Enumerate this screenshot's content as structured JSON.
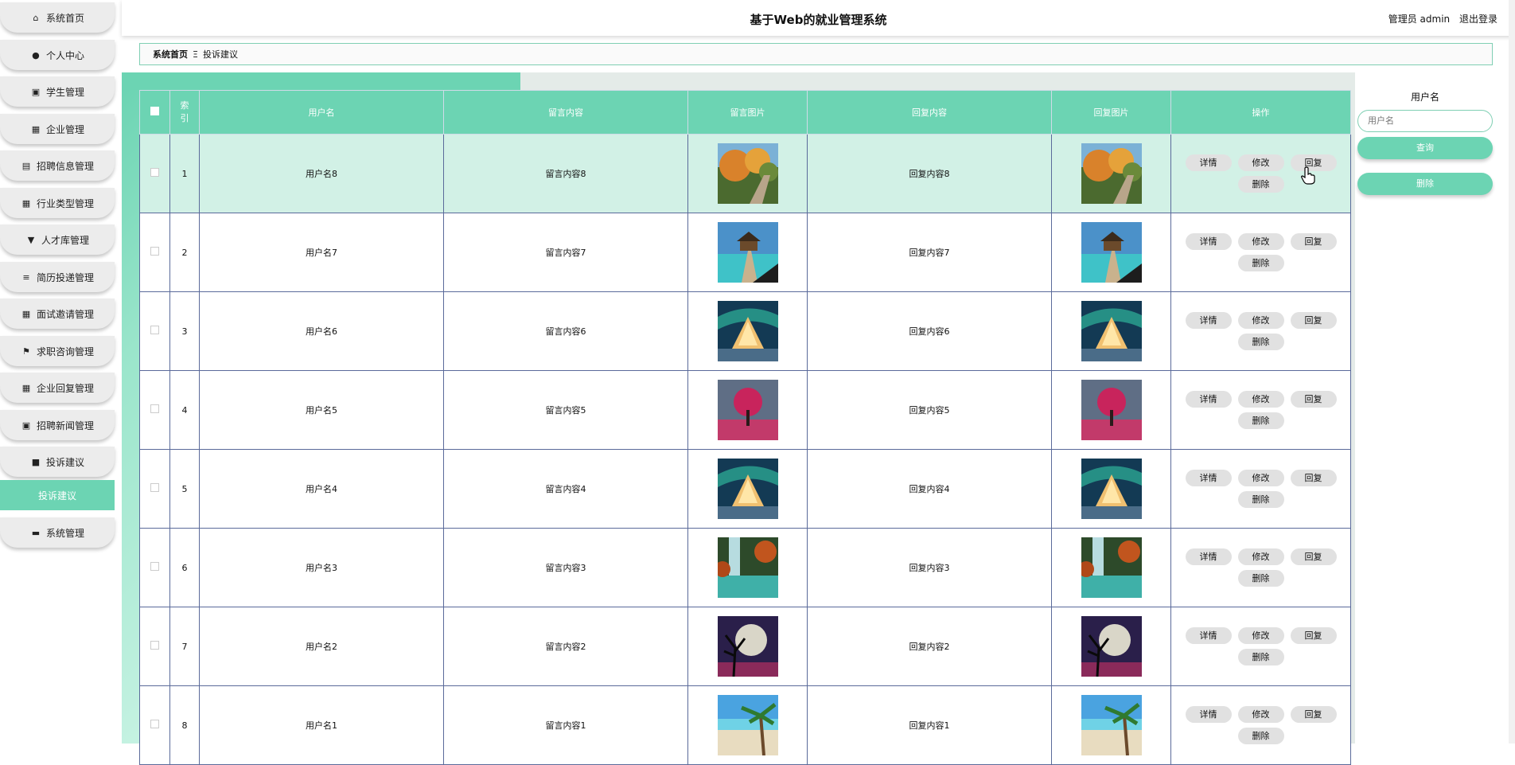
{
  "app": {
    "title": "基于Web的就业管理系统",
    "user_label": "管理员 admin",
    "logout": "退出登录"
  },
  "colors": {
    "accent": "#6cd4b3",
    "row_highlight": "#d2f1e6",
    "button_gray": "#e1e1e1"
  },
  "sidebar": {
    "items": [
      {
        "label": "系统首页",
        "icon": "home-icon"
      },
      {
        "label": "个人中心",
        "icon": "user-icon"
      },
      {
        "label": "学生管理",
        "icon": "clipboard-icon"
      },
      {
        "label": "企业管理",
        "icon": "grid-icon"
      },
      {
        "label": "招聘信息管理",
        "icon": "chart-icon"
      },
      {
        "label": "行业类型管理",
        "icon": "grid-icon"
      },
      {
        "label": "人才库管理",
        "icon": "pin-icon"
      },
      {
        "label": "简历投递管理",
        "icon": "list-icon"
      },
      {
        "label": "面试邀请管理",
        "icon": "grid-icon"
      },
      {
        "label": "求职咨询管理",
        "icon": "flag-icon"
      },
      {
        "label": "企业回复管理",
        "icon": "grid-icon"
      },
      {
        "label": "招聘新闻管理",
        "icon": "clipboard-icon"
      },
      {
        "label": "投诉建议",
        "icon": "video-icon"
      }
    ],
    "active_sub": "投诉建议",
    "last_item": {
      "label": "系统管理",
      "icon": "cabinet-icon"
    }
  },
  "breadcrumb": {
    "home": "系统首页",
    "sep": "Ξ",
    "current": "投诉建议"
  },
  "table": {
    "headers": {
      "index": "索引",
      "username": "用户名",
      "content": "留言内容",
      "image": "留言图片",
      "reply": "回复内容",
      "reply_image": "回复图片",
      "actions": "操作"
    },
    "action_labels": {
      "detail": "详情",
      "edit": "修改",
      "reply": "回复",
      "delete": "删除"
    },
    "rows": [
      {
        "index": "1",
        "username": "用户名8",
        "content": "留言内容8",
        "reply": "回复内容8",
        "image": "autumn-stairs"
      },
      {
        "index": "2",
        "username": "用户名7",
        "content": "留言内容7",
        "reply": "回复内容7",
        "image": "beach-pier"
      },
      {
        "index": "3",
        "username": "用户名6",
        "content": "留言内容6",
        "reply": "回复内容6",
        "image": "aurora-cabin"
      },
      {
        "index": "4",
        "username": "用户名5",
        "content": "留言内容5",
        "reply": "回复内容5",
        "image": "pink-tree"
      },
      {
        "index": "5",
        "username": "用户名4",
        "content": "留言内容4",
        "reply": "回复内容4",
        "image": "aurora-cabin"
      },
      {
        "index": "6",
        "username": "用户名3",
        "content": "留言内容3",
        "reply": "回复内容3",
        "image": "waterfall"
      },
      {
        "index": "7",
        "username": "用户名2",
        "content": "留言内容2",
        "reply": "回复内容2",
        "image": "moon-tree"
      },
      {
        "index": "8",
        "username": "用户名1",
        "content": "留言内容1",
        "reply": "回复内容1",
        "image": "palm-beach"
      }
    ]
  },
  "search": {
    "label": "用户名",
    "placeholder": "用户名",
    "query_button": "查询",
    "delete_button": "删除"
  }
}
